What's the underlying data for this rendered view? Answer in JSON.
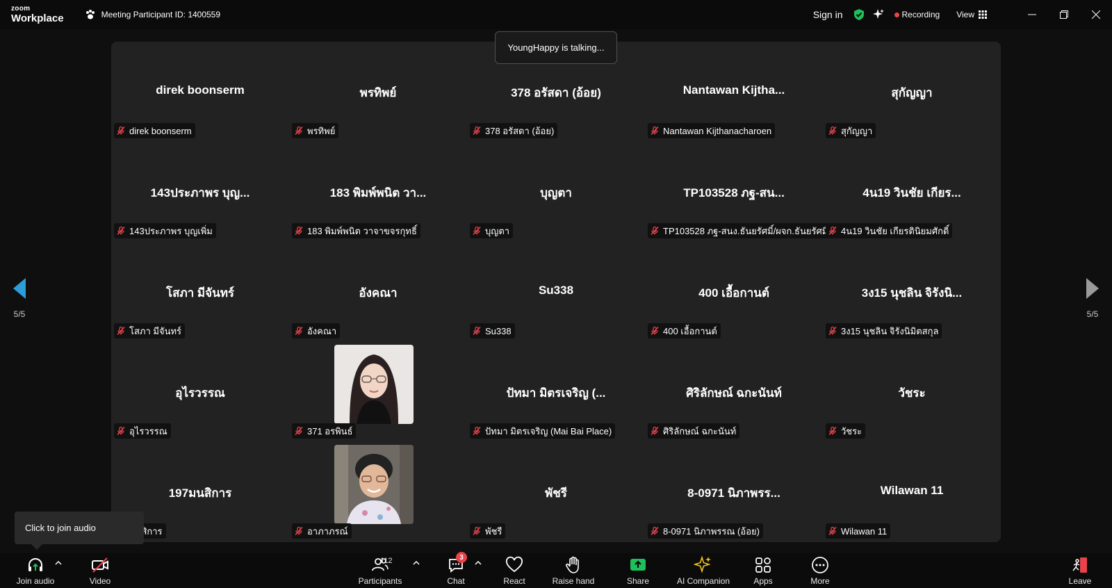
{
  "titlebar": {
    "logo_top": "zoom",
    "logo_bottom": "Workplace",
    "meeting_id": "Meeting Participant ID: 1400559",
    "sign_in": "Sign in",
    "recording": "Recording",
    "view": "View",
    "colors": {
      "shield": "#1fbf5b",
      "recording_dot": "#f2433c"
    }
  },
  "talking_banner": "YoungHappy is talking...",
  "pager": {
    "left_page": "5/5",
    "right_page": "5/5",
    "left_arrow_color": "#2d9cdb"
  },
  "tiles": [
    {
      "display": "direk boonserm",
      "tag": "direk boonserm"
    },
    {
      "display": "พรทิพย์",
      "tag": "พรทิพย์"
    },
    {
      "display": "378 อรัสดา (อ้อย)",
      "tag": "378 อรัสดา (อ้อย)"
    },
    {
      "display": "Nantawan  Kijtha...",
      "tag": "Nantawan Kijthanacharoen"
    },
    {
      "display": "สุกัญญา",
      "tag": "สุกัญญา"
    },
    {
      "display": "143ประภาพร บุญ...",
      "tag": "143ประภาพร บุญเพิ่ม"
    },
    {
      "display": "183  พิมพ์พนิต วา...",
      "tag": "183  พิมพ์พนิต วาจาขจรกุทธิ์"
    },
    {
      "display": "บุญตา",
      "tag": "บุญตา"
    },
    {
      "display": "TP103528 ภฐ-สน...",
      "tag": "TP103528 ภฐ-สนง.ธันยรัศมิ์/ผจก.ธันยรัศมิ์"
    },
    {
      "display": "4น19 วินชัย เกียร...",
      "tag": "4น19 วินชัย เกียรตินิยมศักดิ์"
    },
    {
      "display": "โสภา มีจันทร์",
      "tag": "โสภา มีจันทร์"
    },
    {
      "display": "อังคณา",
      "tag": "อังคณา"
    },
    {
      "display": "Su338",
      "tag": "Su338"
    },
    {
      "display": "400 เอื้อกานต์",
      "tag": "400 เอื้อกานต์"
    },
    {
      "display": "3ง15 นุชลิน จิรังนิ...",
      "tag": "3ง15 นุชลิน จิรังนิมิตสกุล"
    },
    {
      "display": "อุไรวรรณ",
      "tag": "อุไรวรรณ"
    },
    {
      "display": "",
      "tag": "371 อรพินธ์",
      "photo": "woman-with-glasses"
    },
    {
      "display": "ปัทมา มิตรเจริญ (...",
      "tag": "ปัทมา มิตรเจริญ (Mai Bai Place)"
    },
    {
      "display": "ศิริลักษณ์ ฉกะนันท์",
      "tag": "ศิริลักษณ์ ฉกะนันท์"
    },
    {
      "display": "วัชระ",
      "tag": "วัชระ"
    },
    {
      "display": "197มนสิการ",
      "tag": "มนสิการ"
    },
    {
      "display": "",
      "tag": "อาภาภรณ์",
      "photo": "older-woman-portrait"
    },
    {
      "display": "พัชรี",
      "tag": "พัชรี"
    },
    {
      "display": "8-0971 นิภาพรร...",
      "tag": "8-0971 นิภาพรรณ (อ้อย)"
    },
    {
      "display": "Wilawan 11",
      "tag": "Wilawan 11"
    }
  ],
  "tooltip": "Click to join audio",
  "toolbar": {
    "join_audio": "Join audio",
    "video": "Video",
    "participants": "Participants",
    "participants_count": "112",
    "chat": "Chat",
    "chat_badge": "3",
    "react": "React",
    "raise_hand": "Raise hand",
    "share": "Share",
    "ai_companion": "AI Companion",
    "apps": "Apps",
    "more": "More",
    "leave": "Leave",
    "colors": {
      "share": "#1fbf5b",
      "ai": "#f5c518",
      "leave": "#e8424a",
      "video_off": "#e8424a",
      "join_audio": "#1fbf5b"
    }
  }
}
